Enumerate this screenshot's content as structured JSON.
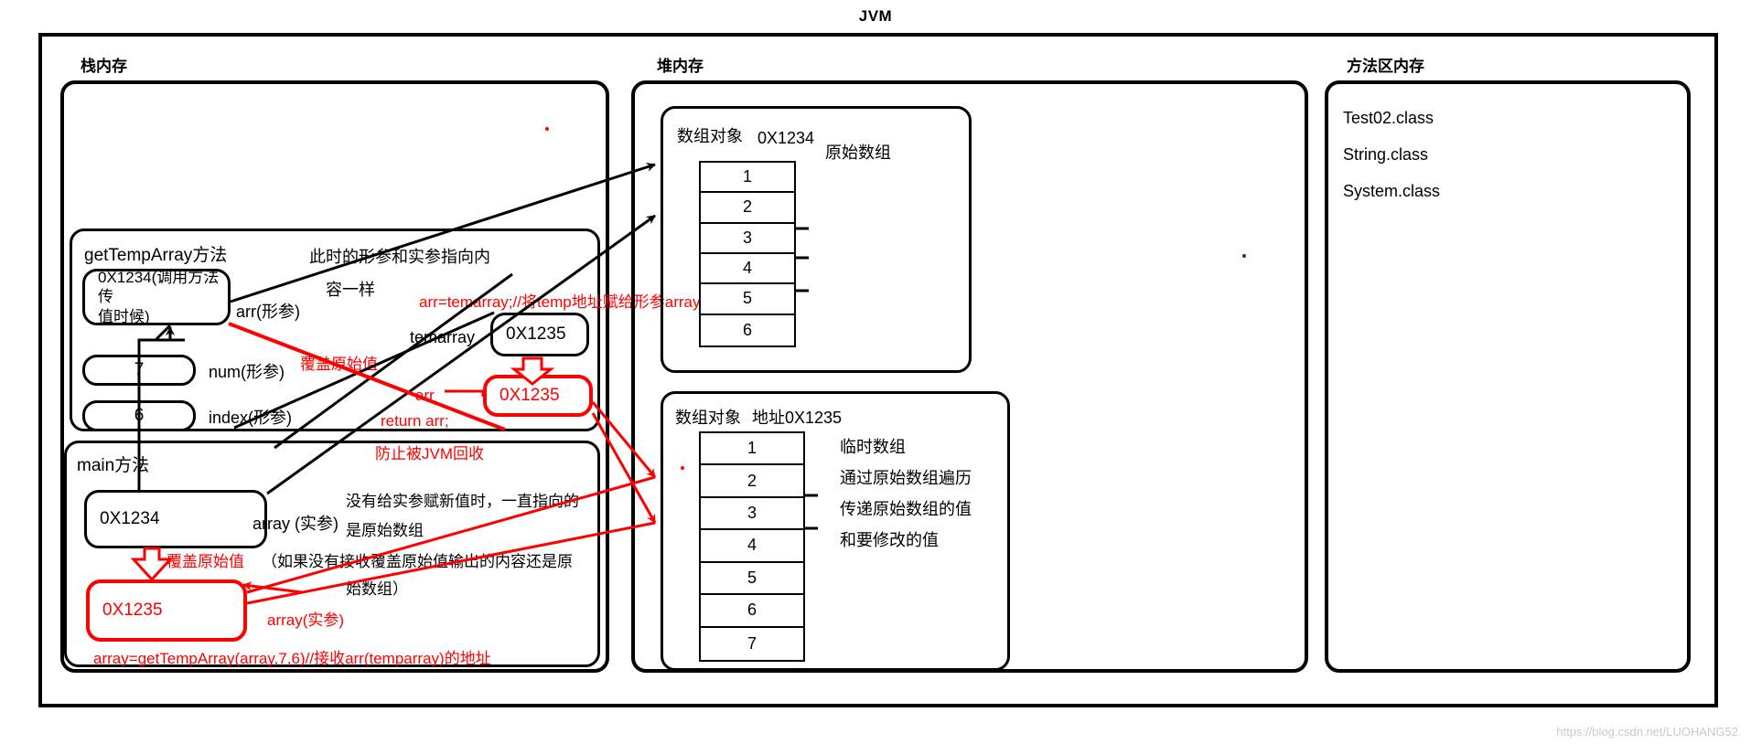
{
  "title": "JVM",
  "watermark": "https://blog.csdn.net/LUOHANG52",
  "colors": {
    "ink": "#000000",
    "accent_red": "#ff0000",
    "watermark": "#c9c9c9"
  },
  "regions": {
    "stack": {
      "label": "栈内存"
    },
    "heap": {
      "label": "堆内存"
    },
    "method_area": {
      "label": "方法区内存"
    }
  },
  "stack": {
    "get_temp_array_frame": {
      "title": "getTempArray方法",
      "addr_box": {
        "line1": "0X1234(调用方法传",
        "line2": "值时候)"
      },
      "addr_box_label": "arr(形参)",
      "num_box": {
        "value": "7"
      },
      "num_box_label": "num(形参)",
      "index_box": {
        "value": "6"
      },
      "index_box_label": "index(形参)",
      "note_same_ref": {
        "line1": "此时的形参和实参指向内",
        "line2": "容一样"
      },
      "temparray_label": "temarray",
      "temparray_box": {
        "value": "0X1235"
      },
      "assign_comment": "arr=temarray;//将temp地址赋给形参array",
      "overwrite_label": "覆盖原始值",
      "arr_label": "arr",
      "return_stmt": "return arr;",
      "arr_result_box": {
        "value": "0X1235"
      },
      "gc_note": "防止被JVM回收"
    },
    "main_frame": {
      "title": "main方法",
      "addr_box": {
        "value": "0X1234"
      },
      "addr_box_label": "array (实参)",
      "note_lines": [
        "没有给实参赋新值时，一直指向的",
        "是原始数组",
        "（如果没有接收覆盖原始值输出的内容还是原",
        "始数组）"
      ],
      "overwrite_label": "覆盖原始值",
      "result_box": {
        "value": "0X1235"
      },
      "result_box_label": "array(实参)",
      "assign_comment": "array=getTempArray(array,7,6)//接收arr(temparray)的地址"
    }
  },
  "heap": {
    "original_array": {
      "object_label": "数组对象",
      "address": "0X1234",
      "caption": "原始数组",
      "cells": [
        "1",
        "2",
        "3",
        "4",
        "5",
        "6"
      ]
    },
    "temp_array": {
      "object_label": "数组对象",
      "address": "地址0X1235",
      "cells": [
        "1",
        "2",
        "3",
        "4",
        "5",
        "6",
        "7"
      ],
      "notes": [
        "临时数组",
        "通过原始数组遍历",
        "传递原始数组的值",
        "和要修改的值"
      ]
    }
  },
  "method_area": {
    "classes": [
      "Test02.class",
      "String.class",
      " System.class"
    ]
  }
}
